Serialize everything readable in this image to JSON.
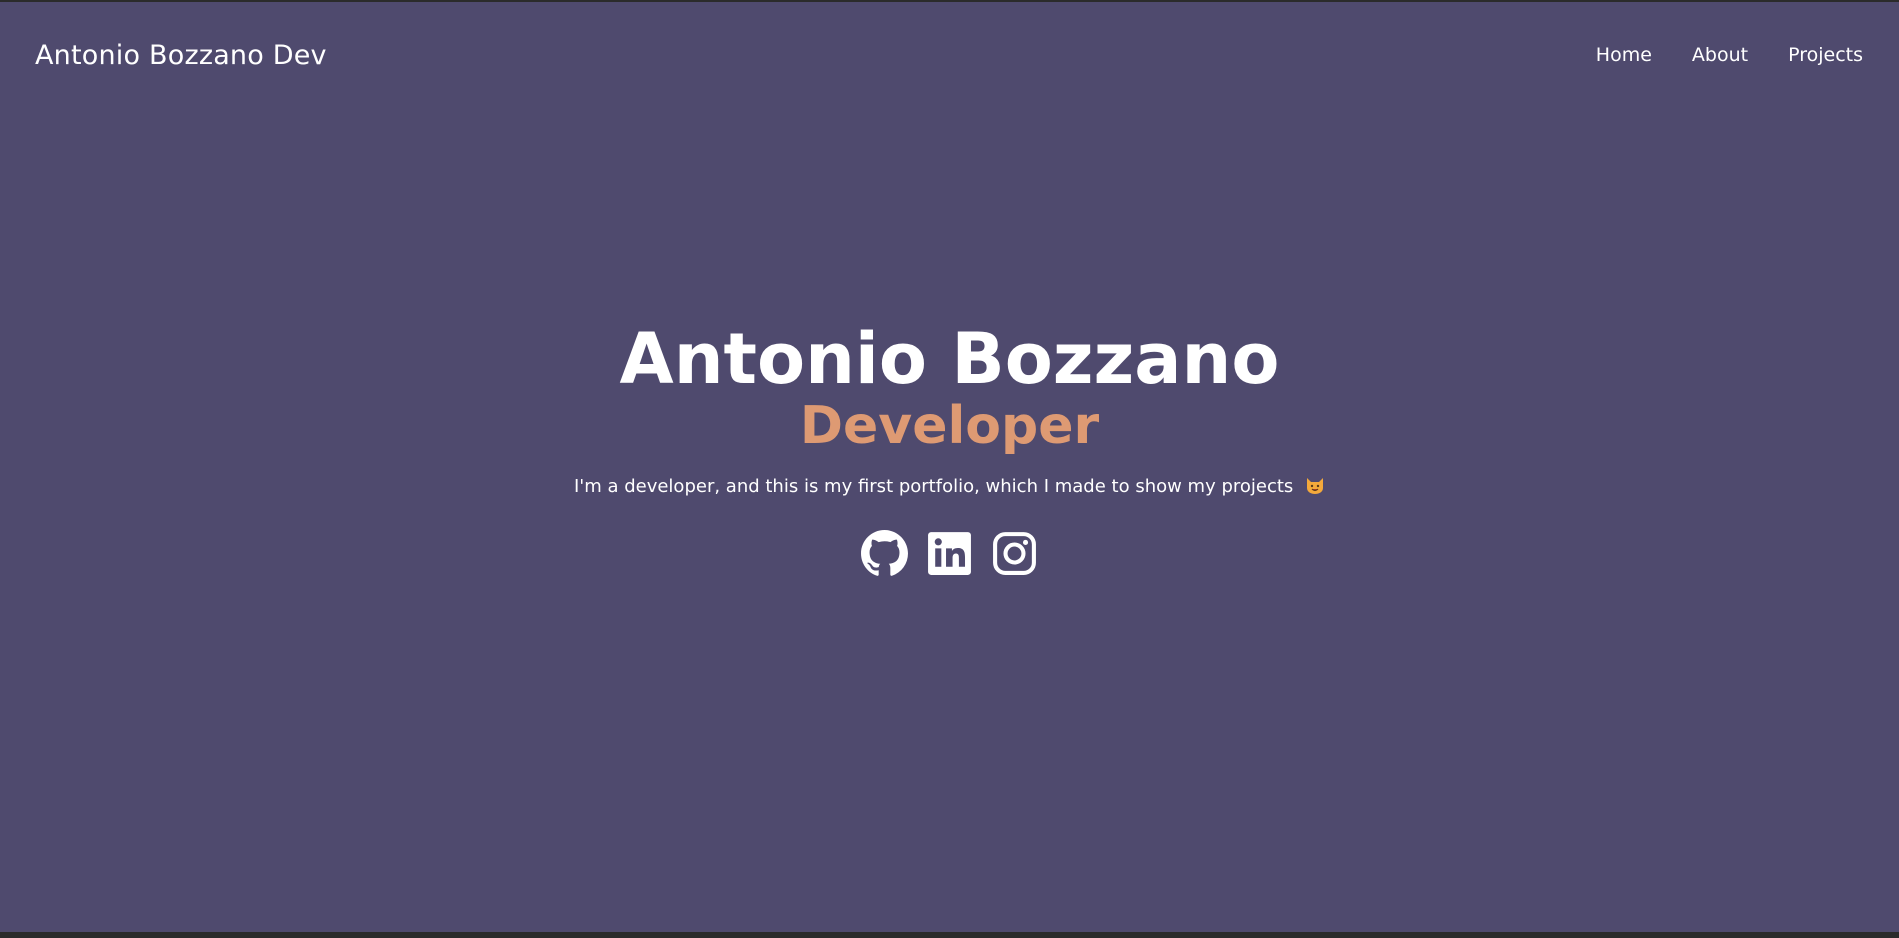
{
  "navbar": {
    "brand": "Antonio Bozzano Dev",
    "links": [
      {
        "label": "Home"
      },
      {
        "label": "About"
      },
      {
        "label": "Projects"
      }
    ]
  },
  "hero": {
    "name": "Antonio Bozzano",
    "role": "Developer",
    "description": "I'm a developer, and this is my first portfolio, which I made to show my projects",
    "emoji": "smiling-cat-emoji"
  },
  "socials": [
    {
      "icon": "github-icon"
    },
    {
      "icon": "linkedin-icon"
    },
    {
      "icon": "instagram-icon"
    }
  ],
  "colors": {
    "background": "#4f4a6e",
    "accent": "#de9a73",
    "text": "#ffffff"
  }
}
